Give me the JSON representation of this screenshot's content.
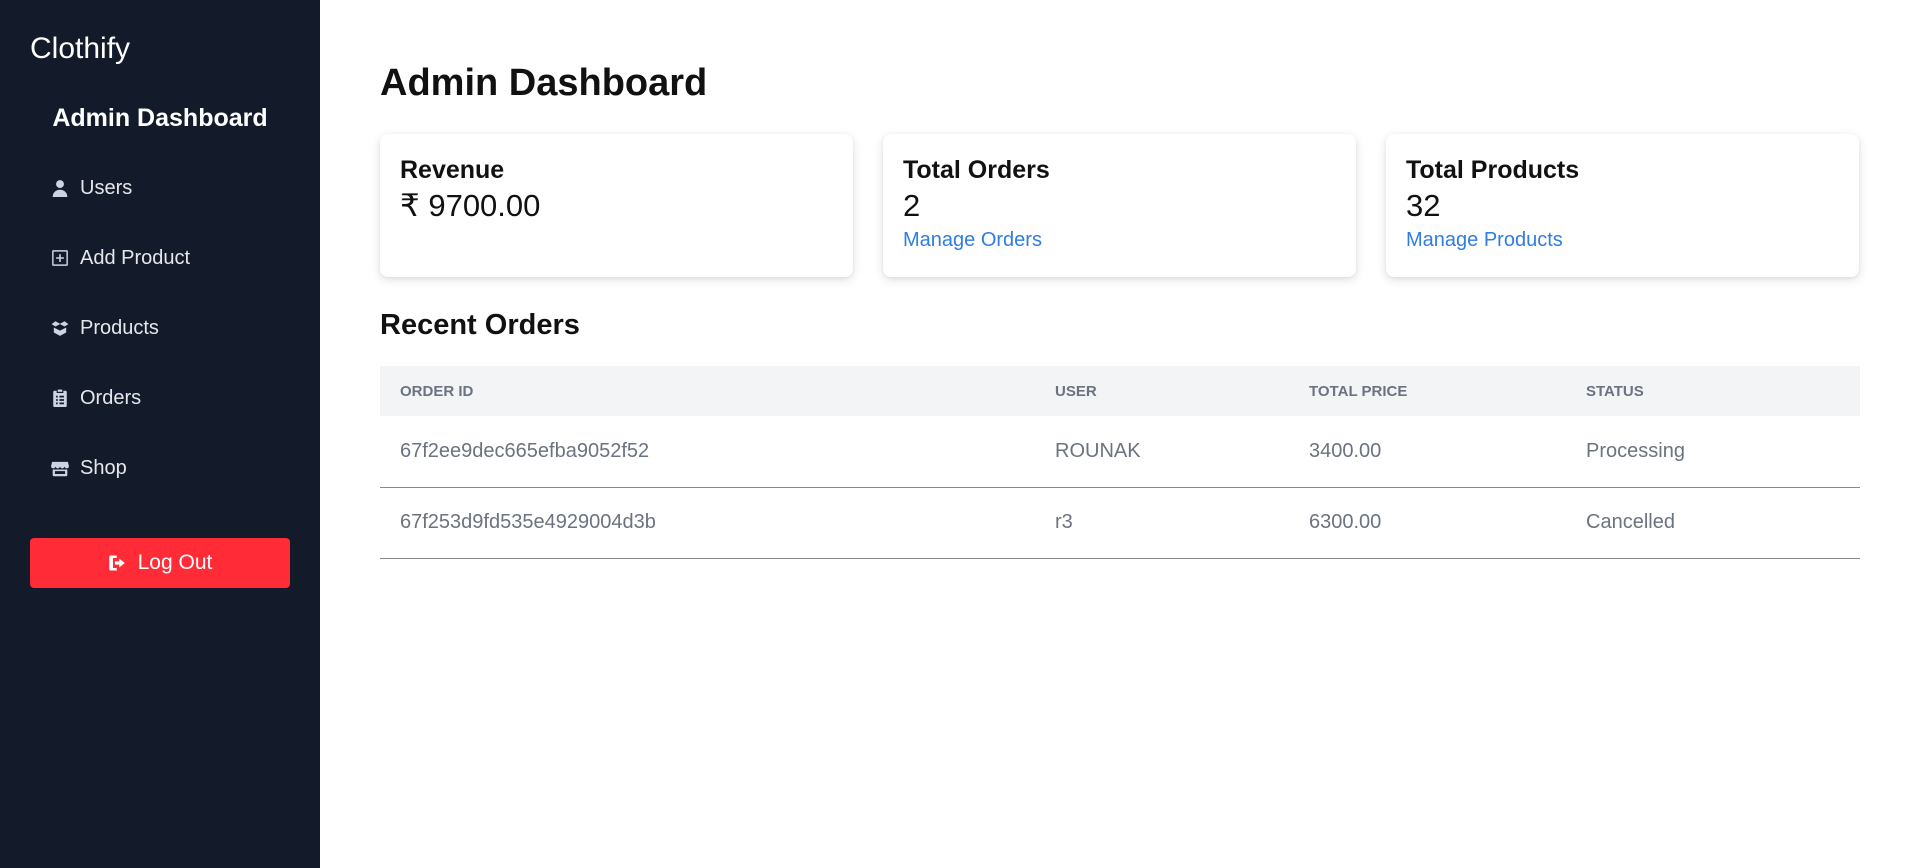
{
  "sidebar": {
    "brand": "Clothify",
    "title": "Admin Dashboard",
    "items": [
      {
        "label": "Users",
        "icon": "user-icon"
      },
      {
        "label": "Add Product",
        "icon": "plus-square-icon"
      },
      {
        "label": "Products",
        "icon": "box-open-icon"
      },
      {
        "label": "Orders",
        "icon": "clipboard-list-icon"
      },
      {
        "label": "Shop",
        "icon": "store-icon"
      }
    ],
    "logout_label": "Log Out"
  },
  "main": {
    "title": "Admin Dashboard",
    "cards": [
      {
        "title": "Revenue",
        "value": "₹ 9700.00",
        "link": ""
      },
      {
        "title": "Total Orders",
        "value": "2",
        "link": "Manage Orders"
      },
      {
        "title": "Total Products",
        "value": "32",
        "link": "Manage Products"
      }
    ],
    "recent_orders": {
      "title": "Recent Orders",
      "columns": [
        "Order ID",
        "User",
        "Total Price",
        "Status"
      ],
      "rows": [
        {
          "order_id": "67f2ee9dec665efba9052f52",
          "user": "ROUNAK",
          "total_price": "3400.00",
          "status": "Processing"
        },
        {
          "order_id": "67f253d9fd535e4929004d3b",
          "user": "r3",
          "total_price": "6300.00",
          "status": "Cancelled"
        }
      ]
    }
  },
  "colors": {
    "sidebar_bg": "#131a2a",
    "logout_bg": "#ff2b36",
    "link": "#2f7de1",
    "table_header_bg": "#f3f4f6"
  }
}
